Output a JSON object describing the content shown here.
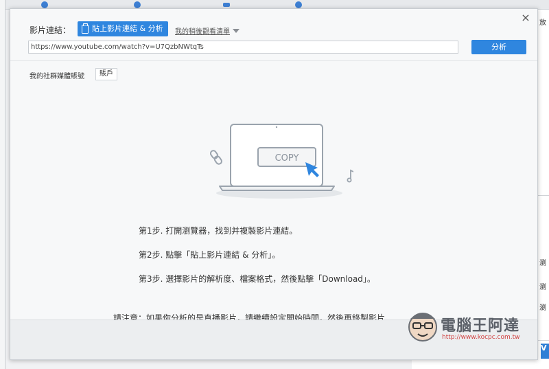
{
  "dialog": {
    "link_label": "影片連結：",
    "paste_button": "貼上影片連結 & 分析",
    "watch_later_link": "我的稍後觀看清單",
    "url_value": "https://www.youtube.com/watch?v=U7QzbNWtqTs",
    "analyze_button": "分析",
    "social_label": "我的社群媒體賬號",
    "account_button": "賬戶",
    "illustration_text": "COPY",
    "steps": [
      "第1步. 打開瀏覽器，找到并複製影片連結。",
      "第2步. 點擊「貼上影片連結 & 分析」。",
      "第3步. 選擇影片的解析度、檔案格式，然後點擊「Download」。"
    ],
    "note": "請注意：如果你分析的是直播影片，請繼續設定開始時間，然後再錄製影片",
    "close_symbol": "×"
  },
  "background": {
    "right_labels": [
      "放",
      "瀏",
      "瀏",
      "瀏"
    ],
    "bottom_button": "V"
  },
  "watermark": {
    "title": "電腦王阿達",
    "url": "http://www.kocpc.com.tw"
  },
  "colors": {
    "accent": "#2f86df",
    "illustration_stroke": "#9aa3ad",
    "cursor": "#2f86df"
  }
}
